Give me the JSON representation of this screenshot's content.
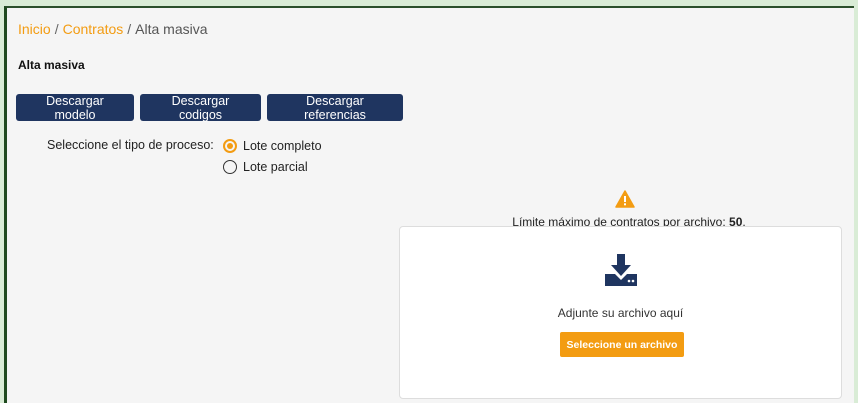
{
  "breadcrumb": {
    "home": "Inicio",
    "separator": "/",
    "contracts": "Contratos",
    "current": "Alta masiva"
  },
  "page_title": "Alta masiva",
  "toolbar": {
    "download_model": "Descargar modelo",
    "download_codes": "Descargar codigos",
    "download_references": "Descargar referencias"
  },
  "process": {
    "label": "Seleccione el tipo de proceso:",
    "options": [
      {
        "label": "Lote completo",
        "selected": true
      },
      {
        "label": "Lote parcial",
        "selected": false
      }
    ]
  },
  "limit": {
    "text": "Límite máximo de contratos por archivo: ",
    "value": "50",
    "suffix": "."
  },
  "upload": {
    "attach_text": "Adjunte su archivo aquí",
    "select_button": "Seleccione un archivo",
    "icon": "download-icon"
  },
  "colors": {
    "accent": "#f39c12",
    "button_dark": "#1f3560",
    "frame_border": "#1f4a1f",
    "page_bg": "#d9ecd6"
  }
}
